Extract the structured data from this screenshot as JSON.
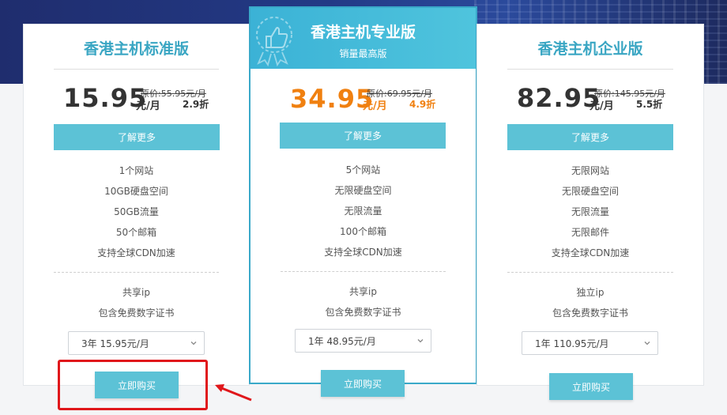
{
  "plans": [
    {
      "title": "香港主机标准版",
      "price": "15.95",
      "original": "原价:55.95元/月",
      "unit": "元/月",
      "discount": "2.9折",
      "learn_more": "了解更多",
      "features": [
        "1个网站",
        "10GB硬盘空间",
        "50GB流量",
        "50个邮箱",
        "支持全球CDN加速"
      ],
      "extras": [
        "共享ip",
        "包含免费数字证书"
      ],
      "select_value": "3年 15.95元/月",
      "buy": "立即购买"
    },
    {
      "title": "香港主机专业版",
      "subtitle": "销量最高版",
      "price": "34.95",
      "original": "原价:69.95元/月",
      "unit": "元/月",
      "discount": "4.9折",
      "learn_more": "了解更多",
      "features": [
        "5个网站",
        "无限硬盘空间",
        "无限流量",
        "100个邮箱",
        "支持全球CDN加速"
      ],
      "extras": [
        "共享ip",
        "包含免费数字证书"
      ],
      "select_value": "1年 48.95元/月",
      "buy": "立即购买"
    },
    {
      "title": "香港主机企业版",
      "price": "82.95",
      "original": "原价:145.95元/月",
      "unit": "元/月",
      "discount": "5.5折",
      "learn_more": "了解更多",
      "features": [
        "无限网站",
        "无限硬盘空间",
        "无限流量",
        "无限邮件",
        "支持全球CDN加速"
      ],
      "extras": [
        "独立ip",
        "包含免费数字证书"
      ],
      "select_value": "1年 110.95元/月",
      "buy": "立即购买"
    }
  ],
  "colors": {
    "accent": "#5cc2d6",
    "title": "#3aa6c3",
    "pro_price": "#f08010",
    "highlight": "#e0171b"
  }
}
